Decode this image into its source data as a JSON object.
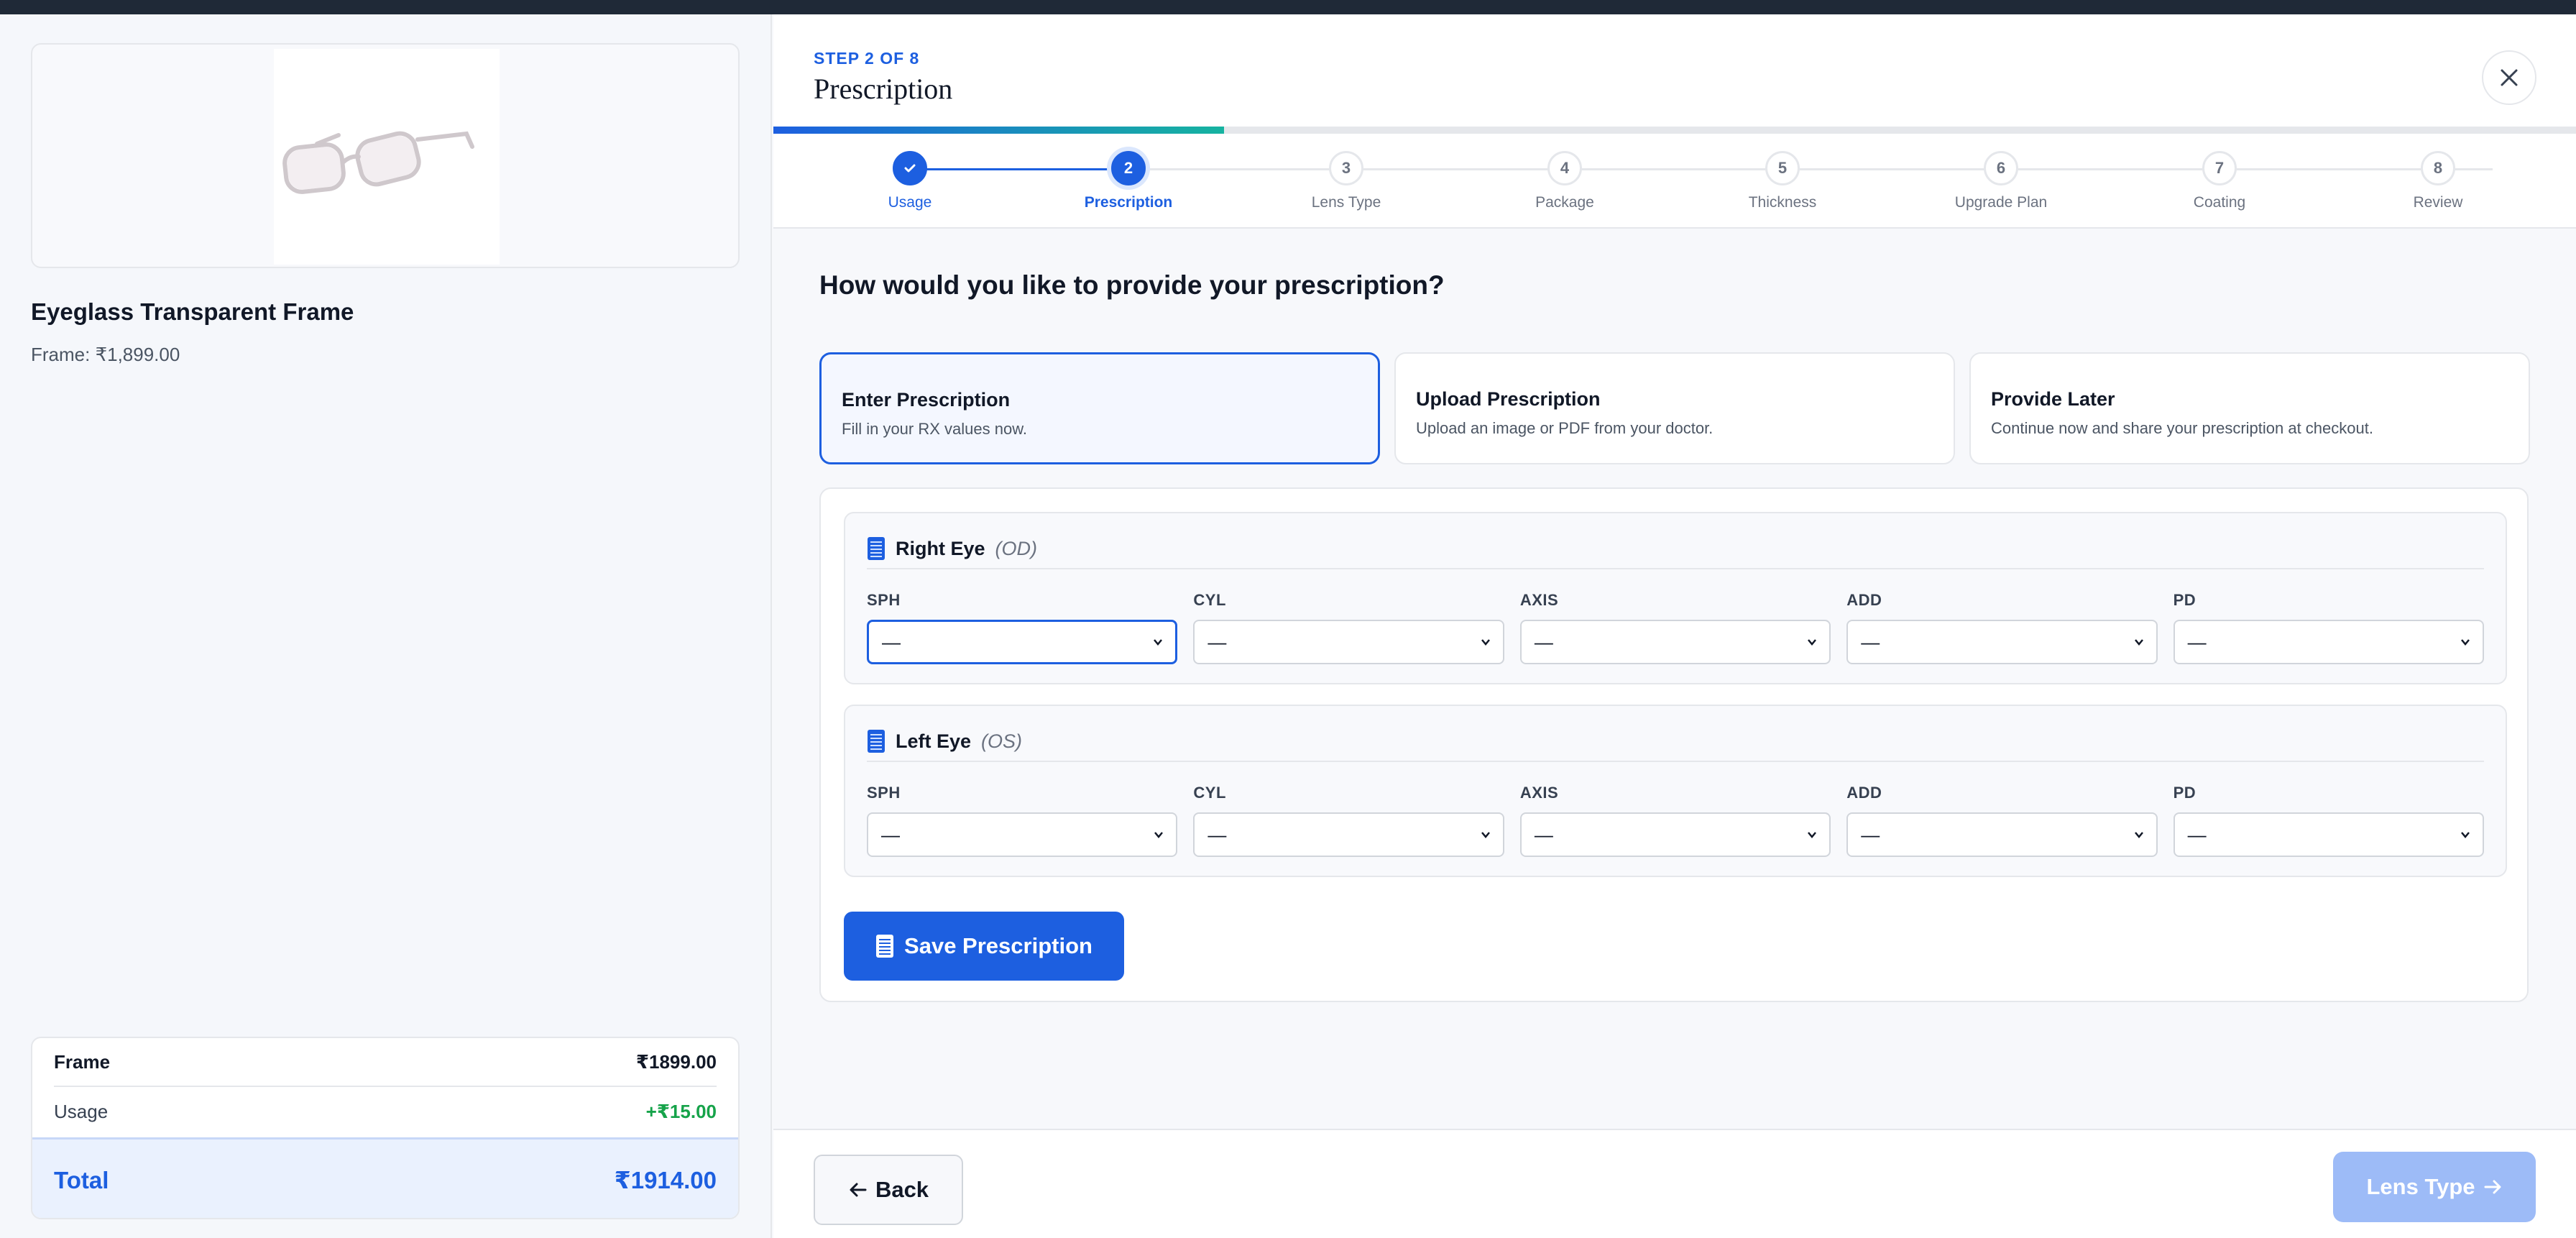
{
  "product": {
    "title": "Eyeglass Transparent Frame",
    "price_line": "Frame: ₹1,899.00"
  },
  "summary": {
    "rows": [
      {
        "label": "Frame",
        "value": "₹1899.00"
      },
      {
        "label": "Usage",
        "value": "+₹15.00"
      }
    ],
    "total_label": "Total",
    "total_value": "₹1914.00"
  },
  "header": {
    "step_label": "STEP 2 OF 8",
    "title": "Prescription",
    "progress_fraction": 0.25
  },
  "steps": [
    {
      "num": "1",
      "label": "Usage",
      "state": "done"
    },
    {
      "num": "2",
      "label": "Prescription",
      "state": "active"
    },
    {
      "num": "3",
      "label": "Lens Type",
      "state": "pending"
    },
    {
      "num": "4",
      "label": "Package",
      "state": "pending"
    },
    {
      "num": "5",
      "label": "Thickness",
      "state": "pending"
    },
    {
      "num": "6",
      "label": "Upgrade Plan",
      "state": "pending"
    },
    {
      "num": "7",
      "label": "Coating",
      "state": "pending"
    },
    {
      "num": "8",
      "label": "Review",
      "state": "pending"
    }
  ],
  "question": "How would you like to provide your prescription?",
  "options": [
    {
      "title": "Enter Prescription",
      "subtitle": "Fill in your RX values now.",
      "selected": true
    },
    {
      "title": "Upload Prescription",
      "subtitle": "Upload an image or PDF from your doctor.",
      "selected": false
    },
    {
      "title": "Provide Later",
      "subtitle": "Continue now and share your prescription at checkout.",
      "selected": false
    }
  ],
  "eyes": {
    "right": {
      "name": "Right Eye",
      "code": "(OD)"
    },
    "left": {
      "name": "Left Eye",
      "code": "(OS)"
    }
  },
  "fields": {
    "labels": [
      "SPH",
      "CYL",
      "AXIS",
      "ADD",
      "PD"
    ],
    "empty_value": "—"
  },
  "save_label": "Save Prescription",
  "footer": {
    "back_label": "Back",
    "next_label": "Lens Type"
  },
  "colors": {
    "accent": "#1d5fe0",
    "success": "#16a34a",
    "next_disabled": "#9dbbf7"
  }
}
